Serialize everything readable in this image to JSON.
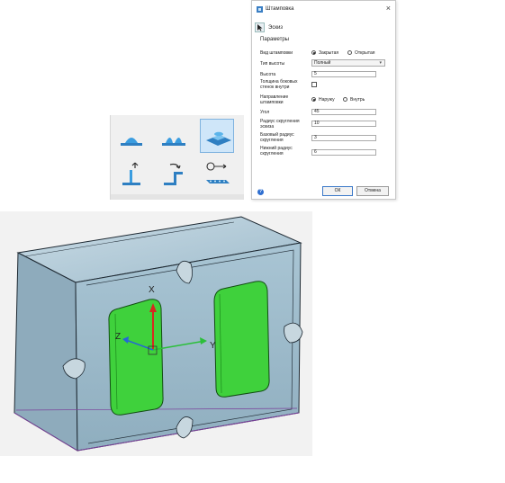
{
  "dialog": {
    "title": "Штамповка",
    "close": "×",
    "sketch_label": "Эскиз",
    "params_header": "Параметры",
    "stamp_type": {
      "label": "Вид штамповки",
      "options": [
        "Закрытая",
        "Открытая"
      ],
      "selected": "Закрытая"
    },
    "height_type": {
      "label": "Тип высоты",
      "value": "Полный"
    },
    "height": {
      "label": "Высота",
      "value": "5"
    },
    "side_walls": {
      "label": "Толщина боковых стенок внутри",
      "checked": false
    },
    "direction": {
      "label": "Направление штамповки",
      "options": [
        "Наружу",
        "Внутрь"
      ],
      "selected": "Наружу"
    },
    "angle": {
      "label": "Угол",
      "value": "45"
    },
    "sketch_radius": {
      "label": "Радиус скругления эскиза",
      "value": "10"
    },
    "base_radius": {
      "label": "Базовый радиус скругления",
      "value": "3"
    },
    "bottom_radius": {
      "label": "Нижний радиус скругления",
      "value": "6"
    },
    "help": "?",
    "ok": "ОК",
    "cancel": "Отмена"
  },
  "toolbar": {
    "tools": [
      {
        "icon": "dome-bump-icon",
        "selected": false
      },
      {
        "icon": "louver-icon",
        "selected": false
      },
      {
        "icon": "stamp-icon",
        "selected": true
      },
      {
        "icon": "hem-flange-icon",
        "selected": false
      },
      {
        "icon": "jog-icon",
        "selected": false
      },
      {
        "icon": "unfold-icon",
        "selected": false
      }
    ]
  },
  "viewport": {
    "axis_labels": {
      "x": "X",
      "y": "Y",
      "z": "Z"
    },
    "colors": {
      "part": "#9fbccc",
      "stamp": "#3fd13c",
      "x_axis": "#d62a1f",
      "y_axis": "#2bbf3a",
      "z_axis": "#2566d6",
      "edge": "#7a3f9a"
    }
  }
}
